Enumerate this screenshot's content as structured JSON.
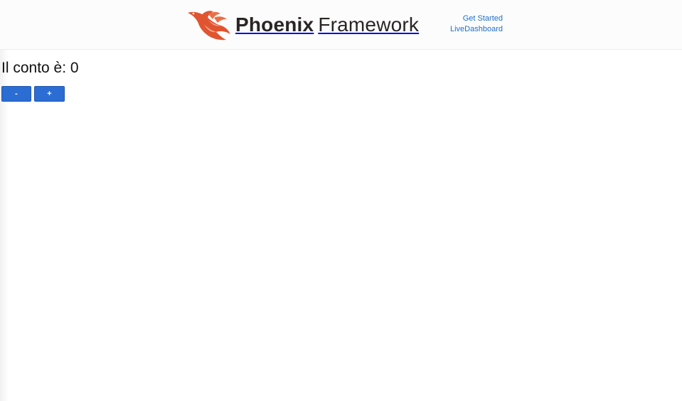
{
  "header": {
    "logo": {
      "brand_bold": "Phoenix",
      "brand_light": "Framework",
      "icon": "phoenix-bird-icon",
      "color": "#e0552f"
    },
    "nav": [
      {
        "label": "Get Started"
      },
      {
        "label": "LiveDashboard"
      }
    ],
    "link_color": "#1f6fc9"
  },
  "main": {
    "title": "Il conto è: 0",
    "buttons": {
      "decrement_label": "-",
      "increment_label": "+"
    },
    "button_color": "#2c6dd4"
  }
}
